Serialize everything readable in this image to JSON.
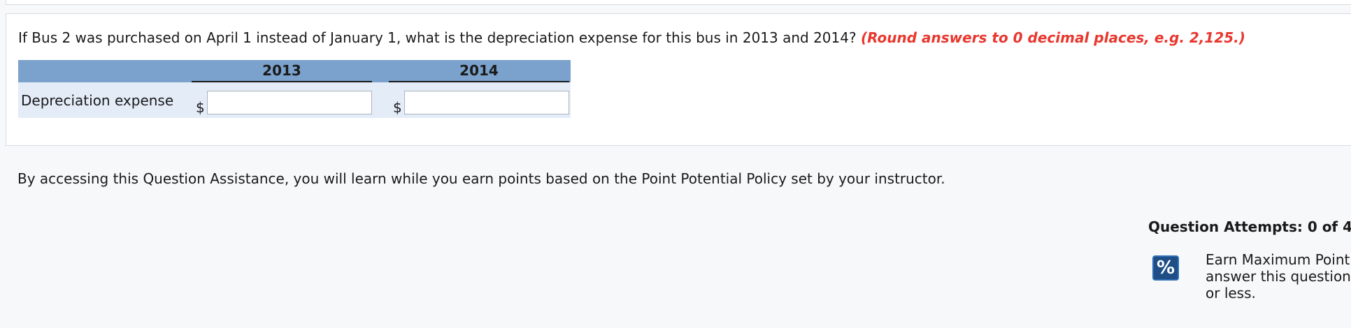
{
  "question": {
    "text": "If Bus 2 was purchased on April 1 instead of January 1, what is the depreciation expense for this bus in 2013 and 2014?",
    "hint": "(Round answers to 0 decimal places, e.g. 2,125.)"
  },
  "table": {
    "columns": [
      "2013",
      "2014"
    ],
    "row_label": "Depreciation expense",
    "currency_symbol": "$",
    "inputs": [
      {
        "value": "",
        "placeholder": ""
      },
      {
        "value": "",
        "placeholder": ""
      }
    ]
  },
  "assistance": {
    "text": "By accessing this Question Assistance, you will learn while you earn points based on the Point Potential Policy set by your instructor."
  },
  "attempts": {
    "label": "Question Attempts: 0 of 4"
  },
  "max_points": {
    "icon": "percent-icon",
    "icon_glyph": "%",
    "lines": [
      "Earn Maximum Point",
      "answer this question",
      "or less."
    ]
  },
  "colors": {
    "hint_red": "#e8372f",
    "table_header": "#7ba2cc",
    "table_row": "#e4ecf8",
    "icon_blue": "#1f4e86"
  }
}
